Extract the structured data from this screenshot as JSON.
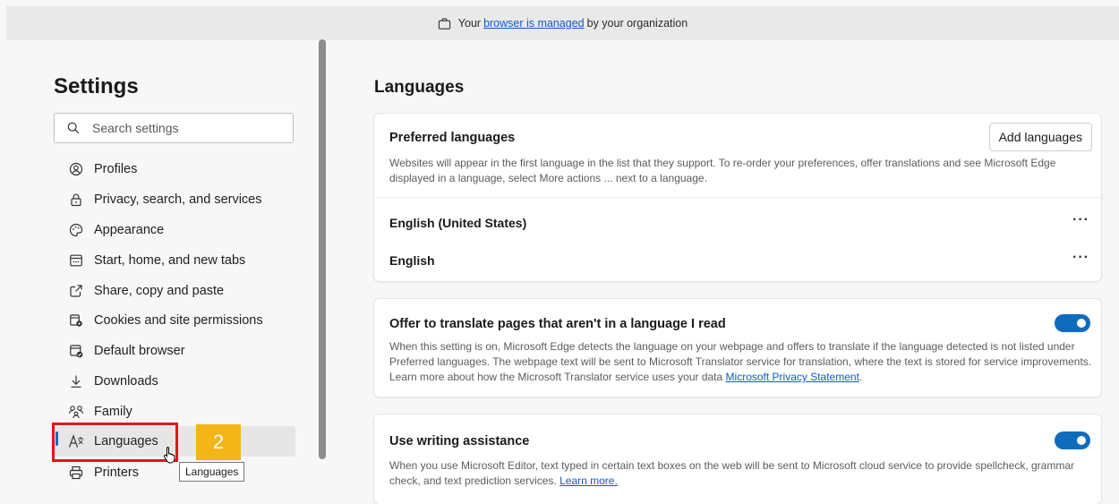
{
  "managed": {
    "before": "Your",
    "link": "browser is managed",
    "after": "by your organization"
  },
  "sidebar": {
    "title": "Settings",
    "search_placeholder": "Search settings",
    "items": [
      {
        "label": "Profiles",
        "icon": "profiles-icon"
      },
      {
        "label": "Privacy, search, and services",
        "icon": "lock-icon"
      },
      {
        "label": "Appearance",
        "icon": "appearance-icon"
      },
      {
        "label": "Start, home, and new tabs",
        "icon": "start-page-icon"
      },
      {
        "label": "Share, copy and paste",
        "icon": "share-icon"
      },
      {
        "label": "Cookies and site permissions",
        "icon": "cookies-icon"
      },
      {
        "label": "Default browser",
        "icon": "default-browser-icon"
      },
      {
        "label": "Downloads",
        "icon": "download-icon"
      },
      {
        "label": "Family",
        "icon": "family-icon"
      },
      {
        "label": "Languages",
        "icon": "languages-icon",
        "active": true
      },
      {
        "label": "Printers",
        "icon": "printer-icon"
      }
    ]
  },
  "annotation": {
    "badge": "2",
    "tooltip": "Languages"
  },
  "main": {
    "title": "Languages",
    "preferred": {
      "heading": "Preferred languages",
      "desc": "Websites will appear in the first language in the list that they support. To re-order your preferences, offer translations and see Microsoft Edge displayed in a language, select More actions ... next to a language.",
      "add_button": "Add languages",
      "languages": [
        "English (United States)",
        "English"
      ],
      "more_label": "···"
    },
    "translate": {
      "heading": "Offer to translate pages that aren't in a language I read",
      "desc": "When this setting is on, Microsoft Edge detects the language on your webpage and offers to translate if the language detected is not listed under Preferred languages. The webpage text will be sent to Microsoft Translator service for translation, where the text is stored for service improvements. Learn more about how the Microsoft Translator service uses your data",
      "link": "Microsoft Privacy Statement",
      "link_suffix": ".",
      "enabled": true
    },
    "writing": {
      "heading": "Use writing assistance",
      "desc": "When you use Microsoft Editor, text typed in certain text boxes on the web will be sent to Microsoft cloud service to provide spellcheck, grammar check, and text prediction services.",
      "link": "Learn more.",
      "enabled": true
    }
  },
  "colors": {
    "accent": "#0f6cbd",
    "highlight_box": "#e3151a",
    "badge": "#f4b517"
  }
}
